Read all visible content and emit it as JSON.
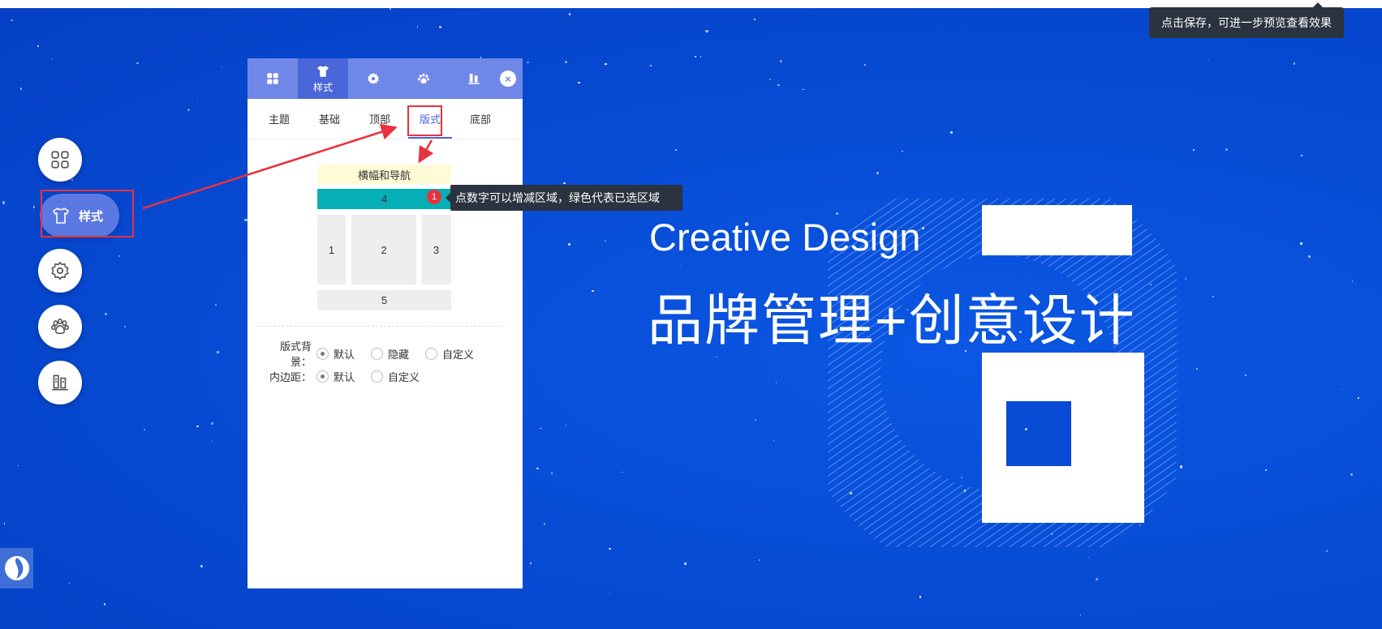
{
  "save_tooltip": "点击保存，可进一步预览查看效果",
  "side_buttons": [
    {
      "name": "apps-icon"
    },
    {
      "name": "style-icon",
      "label": "样式"
    },
    {
      "name": "gear-icon"
    },
    {
      "name": "paw-icon"
    },
    {
      "name": "building-icon"
    }
  ],
  "panel": {
    "tabs": [
      {
        "icon": "grid-icon",
        "label": ""
      },
      {
        "icon": "shirt-icon",
        "label": "样式"
      },
      {
        "icon": "gear-icon",
        "label": ""
      },
      {
        "icon": "paw-icon",
        "label": ""
      },
      {
        "icon": "building-icon",
        "label": ""
      }
    ],
    "close": "×",
    "subtabs": [
      "主题",
      "基础",
      "顶部",
      "版式",
      "底部"
    ],
    "active_subtab": "版式",
    "layout": {
      "banner": "横幅和导航",
      "area4": "4",
      "area1": "1",
      "area2": "2",
      "area3": "3",
      "area5": "5"
    },
    "bg_row": {
      "label": "版式背景：",
      "options": [
        "默认",
        "隐藏",
        "自定义"
      ],
      "selected": "默认"
    },
    "pad_row": {
      "label": "内边距：",
      "options": [
        "默认",
        "自定义"
      ],
      "selected": "默认"
    }
  },
  "area_tooltip": {
    "badge": "1",
    "text": "点数字可以增减区域，绿色代表已选区域"
  },
  "hero": {
    "en": "Creative Design",
    "cn": "品牌管理+创意设计"
  },
  "colors": {
    "accent": "#4b66d8",
    "selected_area": "#06aeb5",
    "banner": "#fffbd7",
    "annotation": "#e8323c"
  }
}
